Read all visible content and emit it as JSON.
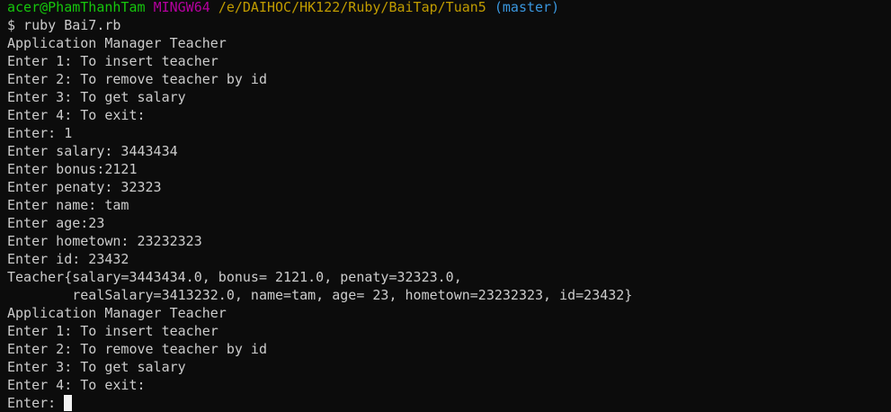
{
  "colors": {
    "background": "#0c0c0c",
    "text": "#cccccc",
    "user_host": "#16c60c",
    "mingw": "#b4009e",
    "path": "#c19c00",
    "branch": "#3a96dd"
  },
  "prompt": {
    "user_host": "acer@PhamThanhTam",
    "system": "MINGW64",
    "path": "/e/DAIHOC/HK122/Ruby/BaiTap/Tuan5",
    "branch": "(master)"
  },
  "lines": [
    "$ ruby Bai7.rb",
    "Application Manager Teacher",
    "Enter 1: To insert teacher",
    "Enter 2: To remove teacher by id",
    "Enter 3: To get salary",
    "Enter 4: To exit:",
    "Enter: 1",
    "Enter salary: 3443434",
    "Enter bonus:2121",
    "Enter penaty: 32323",
    "Enter name: tam",
    "Enter age:23",
    "Enter hometown: 23232323",
    "Enter id: 23432",
    "Teacher{salary=3443434.0, bonus= 2121.0, penaty=32323.0,",
    "        realSalary=3413232.0, name=tam, age= 23, hometown=23232323, id=23432}",
    "Application Manager Teacher",
    "Enter 1: To insert teacher",
    "Enter 2: To remove teacher by id",
    "Enter 3: To get salary",
    "Enter 4: To exit:"
  ],
  "current_input": {
    "prompt": "Enter: "
  }
}
